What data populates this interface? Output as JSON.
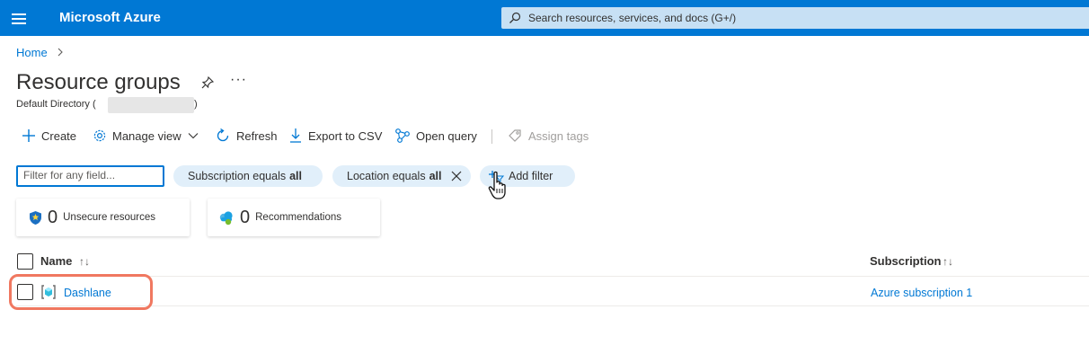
{
  "topbar": {
    "brand": "Microsoft Azure",
    "search_placeholder": "Search resources, services, and docs (G+/)"
  },
  "breadcrumb": {
    "home": "Home"
  },
  "page": {
    "title": "Resource groups",
    "subtitle_prefix": "Default Directory (",
    "subtitle_suffix": ")",
    "more": "···"
  },
  "toolbar": {
    "create": "Create",
    "manage_view": "Manage view",
    "refresh": "Refresh",
    "export_csv": "Export to CSV",
    "open_query": "Open query",
    "assign_tags": "Assign tags"
  },
  "filters": {
    "input_placeholder": "Filter for any field...",
    "subscription_label": "Subscription equals",
    "subscription_value": "all",
    "location_label": "Location equals",
    "location_value": "all",
    "add_filter": "Add filter"
  },
  "cards": {
    "unsecure": {
      "count": "0",
      "label": "Unsecure resources"
    },
    "recommendations": {
      "count": "0",
      "label": "Recommendations"
    }
  },
  "table": {
    "columns": {
      "name": "Name",
      "name_sort": "↑↓",
      "subscription": "Subscription",
      "subscription_sort": "↑↓"
    },
    "rows": [
      {
        "name": "Dashlane",
        "subscription": "Azure subscription 1"
      }
    ]
  },
  "colors": {
    "accent": "#0078d4",
    "highlight": "#f07860"
  }
}
